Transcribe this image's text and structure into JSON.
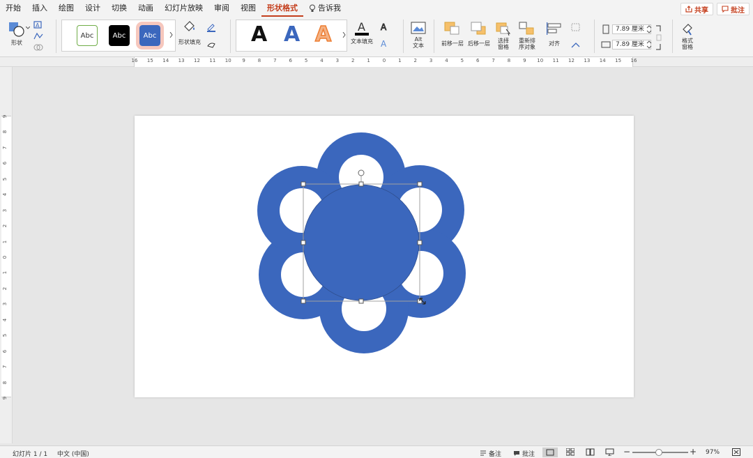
{
  "menu": {
    "items": [
      "开始",
      "插入",
      "绘图",
      "设计",
      "切换",
      "动画",
      "幻灯片放映",
      "审阅",
      "视图",
      "形状格式"
    ],
    "active": "形状格式",
    "tell_me": "告诉我",
    "share": "共享",
    "comments": "批注"
  },
  "ribbon": {
    "shape_label": "形状",
    "shape_fill_label": "形状填充",
    "style_samples": [
      "Abc",
      "Abc",
      "Abc"
    ],
    "wordart_letters": [
      "A",
      "A",
      "A"
    ],
    "text_fill_label": "文本填充",
    "alt_text_line1": "Alt",
    "alt_text_line2": "文本",
    "bring_forward": "前移一层",
    "send_backward": "后移一层",
    "selection_pane_line1": "选择",
    "selection_pane_line2": "窗格",
    "reorder_line1": "重新排",
    "reorder_line2": "序对象",
    "align": "对齐",
    "height_value": "7.89 厘米",
    "width_value": "7.89 厘米",
    "format_pane_line1": "格式",
    "format_pane_line2": "窗格"
  },
  "ruler": {
    "h_labels": [
      "16",
      "15",
      "14",
      "13",
      "12",
      "11",
      "10",
      "9",
      "8",
      "7",
      "6",
      "5",
      "4",
      "3",
      "2",
      "1",
      "0",
      "1",
      "2",
      "3",
      "4",
      "5",
      "6",
      "7",
      "8",
      "9",
      "10",
      "11",
      "12",
      "13",
      "14",
      "15",
      "16"
    ],
    "v_labels": [
      "9",
      "8",
      "7",
      "6",
      "5",
      "4",
      "3",
      "2",
      "1",
      "0",
      "1",
      "2",
      "3",
      "4",
      "5",
      "6",
      "7",
      "8",
      "9"
    ]
  },
  "slide": {
    "shape_color": "#3b67bd"
  },
  "status": {
    "slide_count": "幻灯片 1 / 1",
    "language": "中文 (中国)",
    "notes": "备注",
    "comments": "批注",
    "zoom": "97%"
  },
  "colors": {
    "accent": "#c43e1c",
    "shape_blue": "#3b67bd"
  }
}
